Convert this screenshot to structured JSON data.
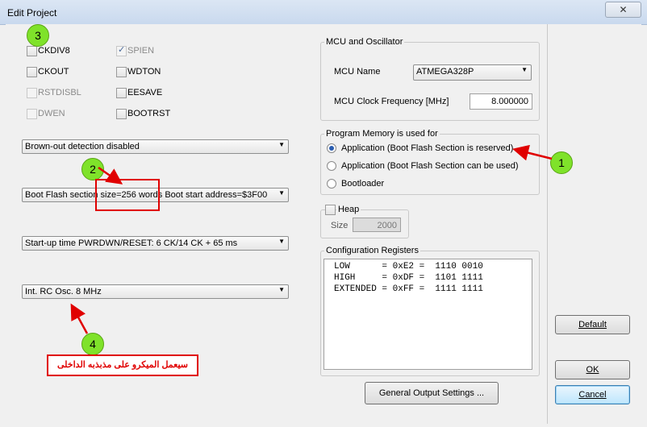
{
  "window": {
    "title": "Edit Project",
    "close_label": "✕"
  },
  "fuses": {
    "left": [
      {
        "label": "CKDIV8",
        "checked": false,
        "disabled": false
      },
      {
        "label": "CKOUT",
        "checked": false,
        "disabled": false
      },
      {
        "label": "RSTDISBL",
        "checked": false,
        "disabled": true
      },
      {
        "label": "DWEN",
        "checked": false,
        "disabled": true
      }
    ],
    "right": [
      {
        "label": "SPIEN",
        "checked": true,
        "disabled": true
      },
      {
        "label": "WDTON",
        "checked": false,
        "disabled": false
      },
      {
        "label": "EESAVE",
        "checked": false,
        "disabled": false
      },
      {
        "label": "BOOTRST",
        "checked": false,
        "disabled": false
      }
    ]
  },
  "dropdowns": {
    "brownout": "Brown-out detection disabled",
    "bootflash": "Boot Flash section size=256 words Boot start address=$3F00",
    "startup": "Start-up time PWRDWN/RESET: 6 CK/14 CK + 65 ms",
    "clock": "Int. RC Osc. 8 MHz"
  },
  "mcu": {
    "group_label": "MCU and Oscillator",
    "name_label": "MCU Name",
    "name_value": "ATMEGA328P",
    "freq_label": "MCU Clock Frequency [MHz]",
    "freq_value": "8.000000"
  },
  "program_memory": {
    "group_label": "Program Memory is used for",
    "options": [
      {
        "label": "Application (Boot Flash Section is reserved)",
        "selected": true
      },
      {
        "label": "Application (Boot Flash Section can be used)",
        "selected": false
      },
      {
        "label": "Bootloader",
        "selected": false
      }
    ]
  },
  "heap": {
    "label": "Heap",
    "size_label": "Size",
    "size_value": "2000"
  },
  "config": {
    "group_label": "Configuration Registers",
    "lines": "LOW      = 0xE2 =  1110 0010\nHIGH     = 0xDF =  1101 1111\nEXTENDED = 0xFF =  1111 1111"
  },
  "buttons": {
    "general": "General Output Settings ...",
    "default": "Default",
    "ok": "OK",
    "cancel": "Cancel"
  },
  "annotations": {
    "b1": "1",
    "b2": "2",
    "b3": "3",
    "b4": "4",
    "note": "سيعمل الميكرو على مذبذبه الداخلى",
    "color": "#e00000",
    "bubble_color": "#7fe22a"
  }
}
